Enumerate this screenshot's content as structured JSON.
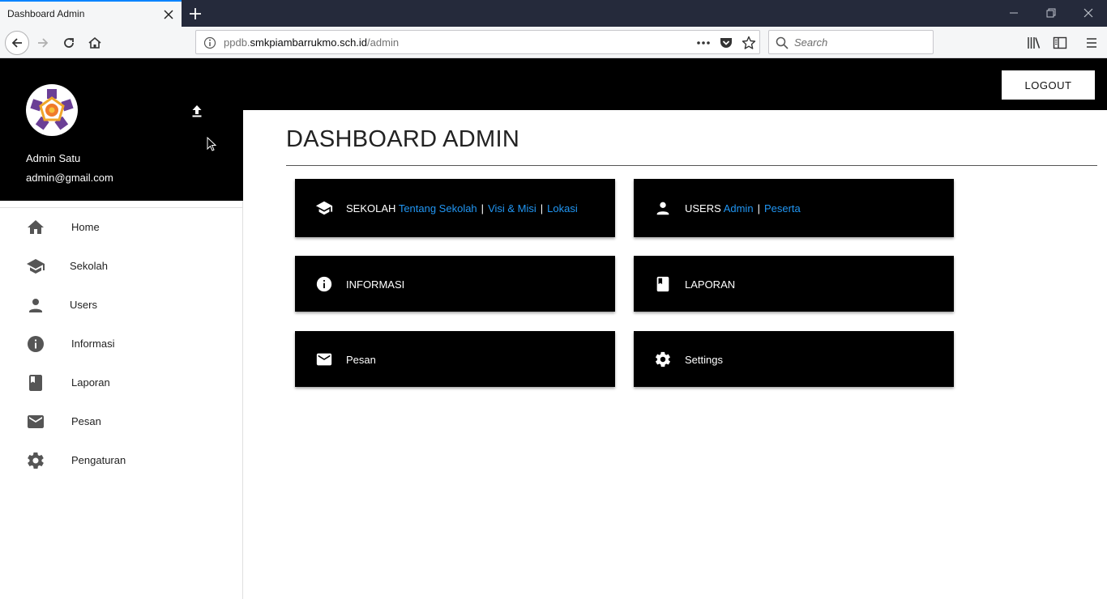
{
  "browser": {
    "tab_title": "Dashboard Admin",
    "url_prefix": "ppdb.",
    "url_host": "smkpiambarrukmo.sch.id",
    "url_path": "/admin",
    "search_placeholder": "Search"
  },
  "header": {
    "logout_label": "LOGOUT"
  },
  "profile": {
    "name": "Admin Satu",
    "email": "admin@gmail.com"
  },
  "sidebar": {
    "items": [
      {
        "label": "Home",
        "icon": "home-icon"
      },
      {
        "label": "Sekolah",
        "icon": "school-icon"
      },
      {
        "label": "Users",
        "icon": "person-icon"
      },
      {
        "label": "Informasi",
        "icon": "info-icon"
      },
      {
        "label": "Laporan",
        "icon": "book-icon"
      },
      {
        "label": "Pesan",
        "icon": "mail-icon"
      },
      {
        "label": "Pengaturan",
        "icon": "gear-icon"
      }
    ]
  },
  "main": {
    "title": "DASHBOARD ADMIN",
    "cards": {
      "sekolah": {
        "label": "SEKOLAH",
        "links": [
          "Tentang Sekolah",
          "Visi & Misi",
          "Lokasi"
        ]
      },
      "users": {
        "label": "USERS",
        "links": [
          "Admin",
          "Peserta"
        ]
      },
      "informasi": {
        "label": "INFORMASI"
      },
      "laporan": {
        "label": "LAPORAN"
      },
      "pesan": {
        "label": "Pesan"
      },
      "settings": {
        "label": "Settings"
      }
    },
    "link_color": "#2196f3"
  }
}
